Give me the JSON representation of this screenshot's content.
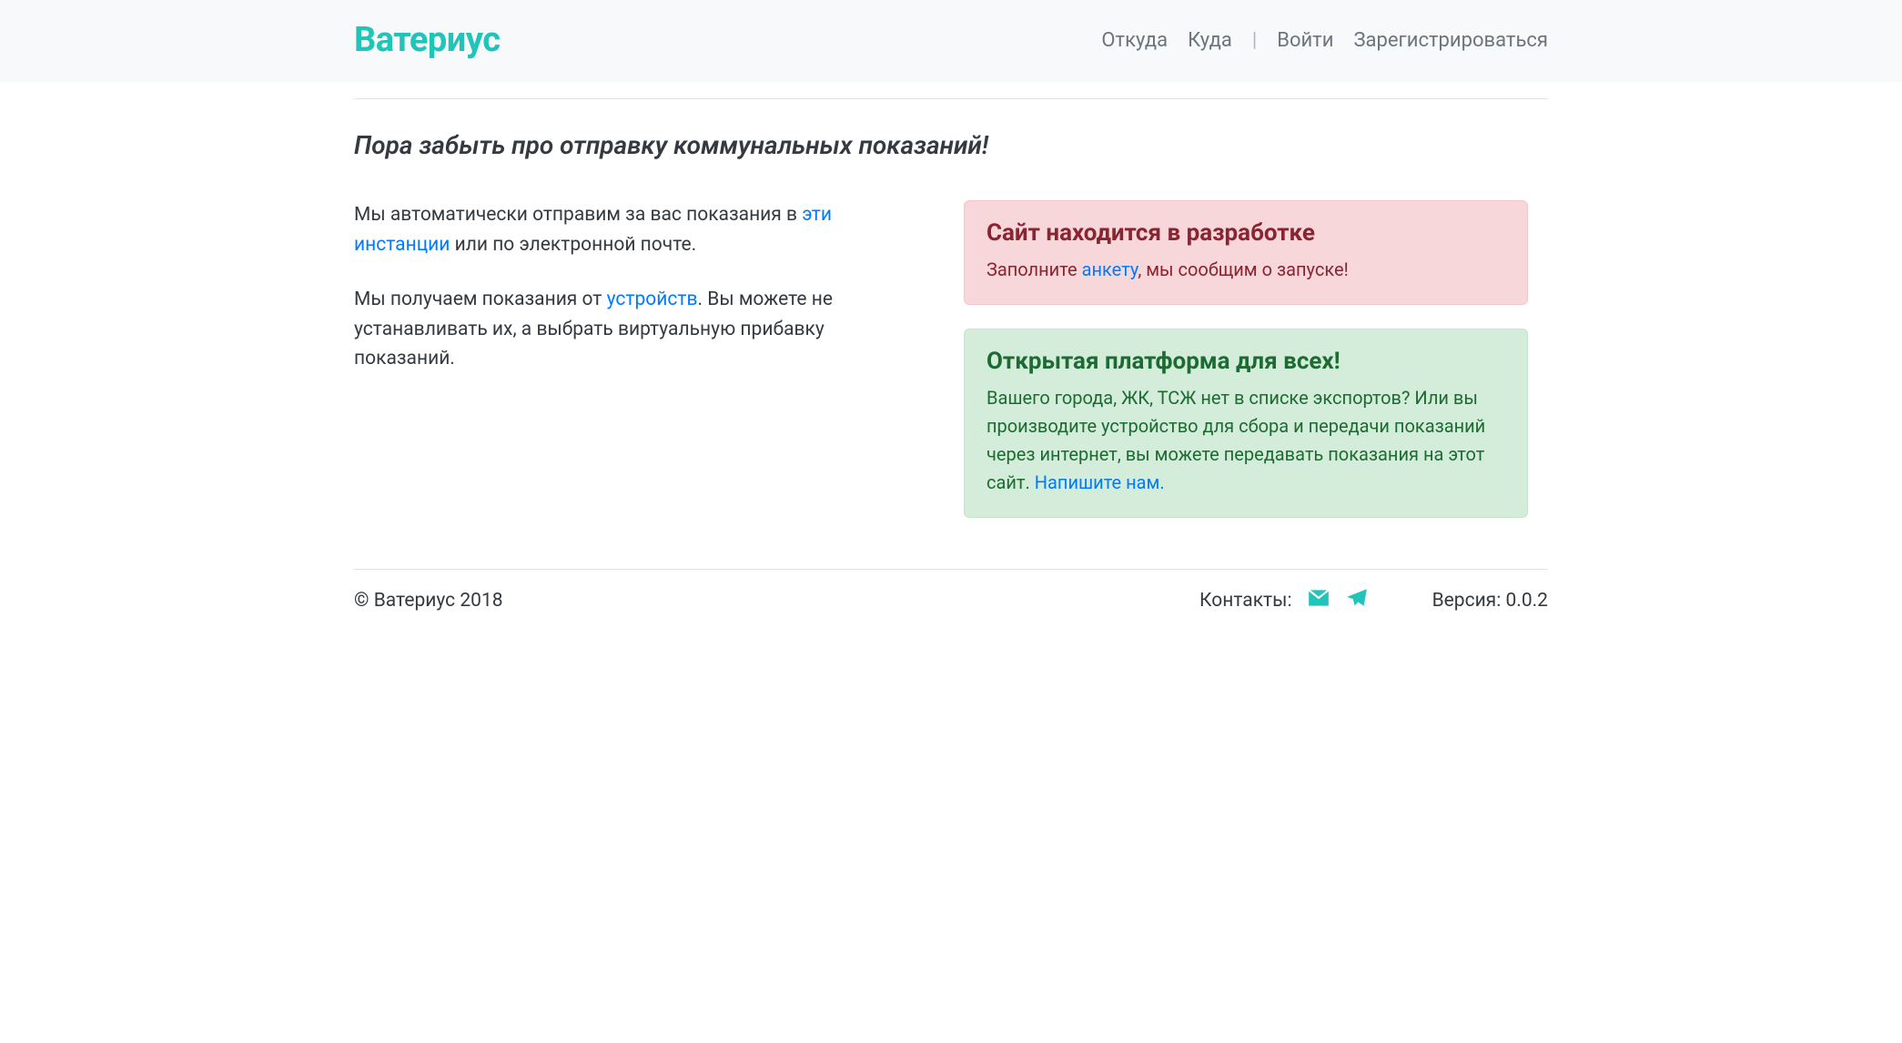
{
  "colors": {
    "brand": "#20c4b8",
    "link": "#007bff",
    "danger_text": "#8a2431",
    "success_text": "#1d6b33"
  },
  "header": {
    "brand": "Ватериус",
    "nav": {
      "from": "Откуда",
      "to": "Куда",
      "login": "Войти",
      "register": "Зарегистрироваться"
    }
  },
  "main": {
    "tagline": "Пора забыть про отправку коммунальных показаний!",
    "p1_a": "Мы автоматически отправим за вас показания в ",
    "p1_link": "эти инстанции",
    "p1_b": " или по электронной почте.",
    "p2_a": "Мы получаем показания от ",
    "p2_link": "устройств",
    "p2_b": ". Вы можете не устанавливать их, а выбрать виртуальную прибавку показаний.",
    "alert_danger": {
      "title": "Сайт находится в разработке",
      "text_a": "Заполните ",
      "link": "анкету",
      "text_b": ", мы сообщим о запуске!"
    },
    "alert_success": {
      "title": "Открытая платформа для всех!",
      "text_a": "Вашего города, ЖК, ТСЖ нет в списке экспортов? Или вы производите устройство для сбора и передачи показаний через интернет, вы можете передавать показания на этот сайт. ",
      "link": "Напишите нам."
    }
  },
  "footer": {
    "copyright": "© Ватериус 2018",
    "contacts_label": "Контакты:",
    "version_label": "Версия: 0.0.2"
  }
}
